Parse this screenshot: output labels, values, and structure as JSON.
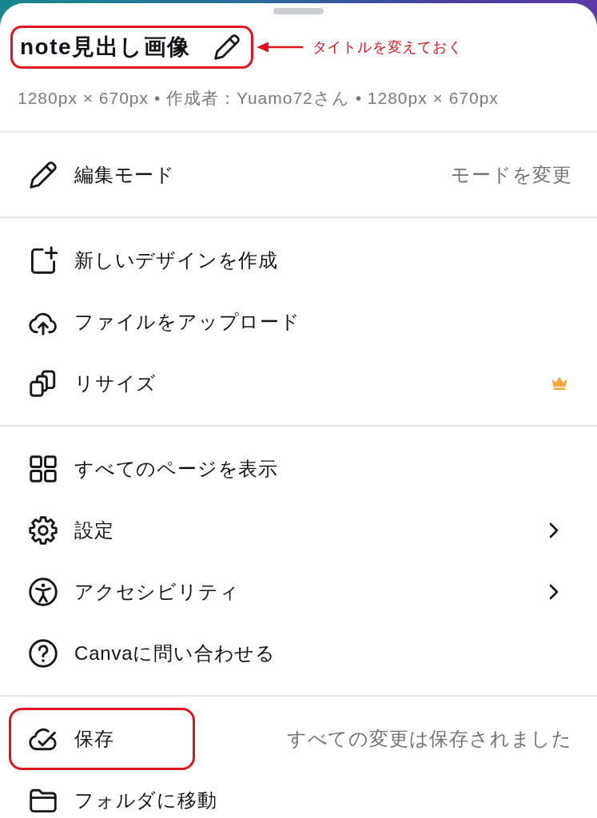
{
  "header": {
    "title": "note見出し画像",
    "highlighted": true,
    "annotation": "タイトルを変えておく",
    "meta": "1280px × 670px • 作成者：Yuamo72さん • 1280px × 670px"
  },
  "sections": [
    {
      "items": [
        {
          "label": "編集モード",
          "detail": "モードを変更",
          "premium": false,
          "submenu": false,
          "highlighted": false
        }
      ]
    },
    {
      "items": [
        {
          "label": "新しいデザインを作成",
          "premium": false,
          "submenu": false,
          "highlighted": false
        },
        {
          "label": "ファイルをアップロード",
          "premium": false,
          "submenu": false,
          "highlighted": false
        },
        {
          "label": "リサイズ",
          "premium": true,
          "submenu": false,
          "highlighted": false
        }
      ]
    },
    {
      "items": [
        {
          "label": "すべてのページを表示",
          "premium": false,
          "submenu": false,
          "highlighted": false
        },
        {
          "label": "設定",
          "premium": false,
          "submenu": true,
          "highlighted": false
        },
        {
          "label": "アクセシビリティ",
          "premium": false,
          "submenu": true,
          "highlighted": false
        },
        {
          "label": "Canvaに問い合わせる",
          "premium": false,
          "submenu": false,
          "highlighted": false
        }
      ]
    },
    {
      "items": [
        {
          "label": "保存",
          "detail": "すべての変更は保存されました",
          "premium": false,
          "submenu": false,
          "highlighted": true
        },
        {
          "label": "フォルダに移動",
          "premium": false,
          "submenu": false,
          "highlighted": false
        }
      ]
    }
  ]
}
